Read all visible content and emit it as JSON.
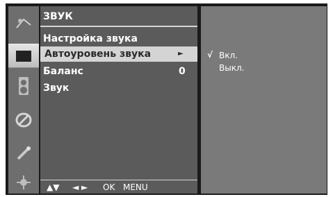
{
  "menu": {
    "title": "ЗВУК",
    "items": [
      {
        "label": "Настройка звука"
      },
      {
        "label": "Автоуровень звука",
        "arrow": "►"
      },
      {
        "label": "Баланс",
        "value": "0"
      },
      {
        "label": "Звук"
      }
    ],
    "selected_index": 1
  },
  "submenu": {
    "check_mark": "√",
    "options": [
      "Вкл.",
      "Выкл."
    ],
    "selected_option": "Вкл."
  },
  "footer": {
    "nav_updown": "▲▼",
    "nav_leftright": "◄ ►",
    "ok": "OK",
    "menu": "MENU"
  },
  "sidebar": {
    "icons": [
      "picture-icon",
      "screen-icon",
      "audio-icon",
      "time-icon",
      "key-icon",
      "settings-icon"
    ],
    "active_index": 1
  },
  "colors": {
    "menu_bg": "#5b5b5b",
    "submenu_bg": "#7a7a7a",
    "highlight": "#d4d4d4",
    "frame": "#1a1a1a"
  }
}
